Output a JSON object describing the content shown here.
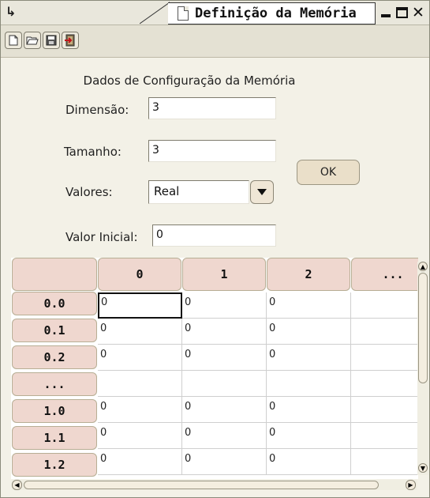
{
  "window": {
    "title": "Definição da Memória",
    "corner_glyph": "↳"
  },
  "toolbar": {
    "buttons": [
      {
        "name": "new-document",
        "icon": "new-file-icon"
      },
      {
        "name": "open-folder",
        "icon": "open-folder-icon"
      },
      {
        "name": "save",
        "icon": "floppy-disk-icon"
      },
      {
        "name": "exit",
        "icon": "exit-door-icon"
      }
    ]
  },
  "form": {
    "title": "Dados de Configuração da Memória",
    "dimension_label": "Dimensão:",
    "dimension_value": "3",
    "size_label": "Tamanho:",
    "size_value": "3",
    "values_label": "Valores:",
    "values_selected": "Real",
    "initial_value_label": "Valor Inicial:",
    "initial_value": "0",
    "ok_label": "OK"
  },
  "table": {
    "columns": [
      "",
      "0",
      "1",
      "2",
      "..."
    ],
    "rows": [
      {
        "label": "0.0",
        "cells": [
          "0",
          "0",
          "0",
          ""
        ]
      },
      {
        "label": "0.1",
        "cells": [
          "0",
          "0",
          "0",
          ""
        ]
      },
      {
        "label": "0.2",
        "cells": [
          "0",
          "0",
          "0",
          ""
        ]
      },
      {
        "label": "...",
        "cells": [
          "",
          "",
          "",
          ""
        ]
      },
      {
        "label": "1.0",
        "cells": [
          "0",
          "0",
          "0",
          ""
        ]
      },
      {
        "label": "1.1",
        "cells": [
          "0",
          "0",
          "0",
          ""
        ]
      },
      {
        "label": "1.2",
        "cells": [
          "0",
          "0",
          "0",
          ""
        ]
      }
    ]
  },
  "colors": {
    "header_fill": "#efd7cf",
    "window_bg": "#f3f1e7"
  }
}
